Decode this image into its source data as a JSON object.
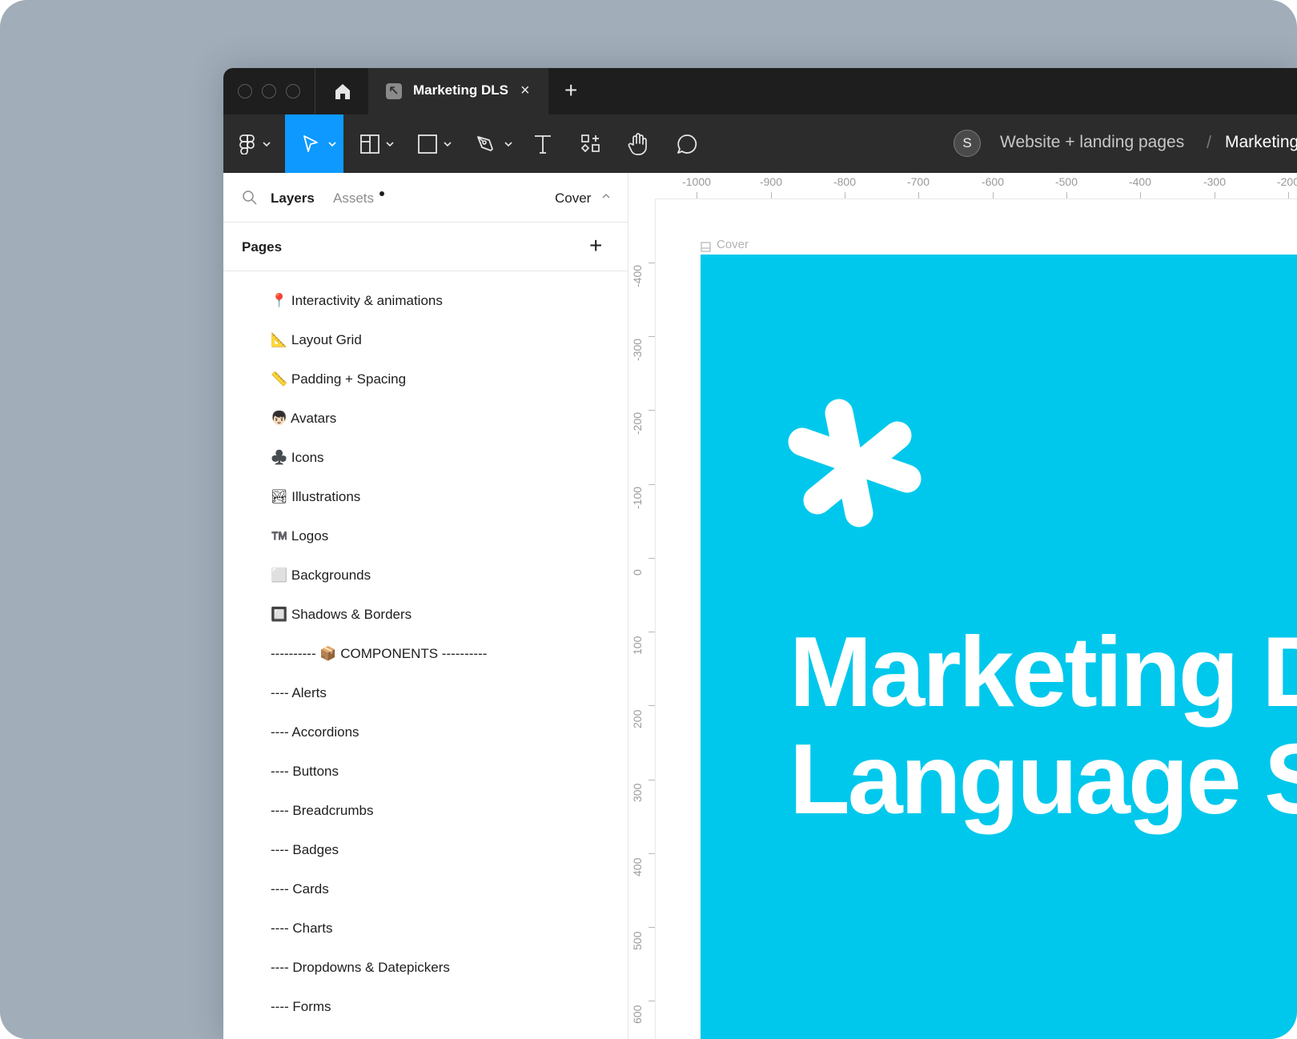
{
  "titlebar": {
    "tab_title": "Marketing DLS",
    "tab_close": "×",
    "new_tab": "+"
  },
  "toolbar": {
    "avatar_initial": "S",
    "project_name": "Website + landing pages",
    "breadcrumb_separator": "/",
    "file_name": "Marketing DLS",
    "active_tool": "move",
    "accent_color": "#0d99ff"
  },
  "panel": {
    "tab_layers": "Layers",
    "tab_assets": "Assets",
    "page_selector": "Cover",
    "pages_title": "Pages",
    "add_page": "+",
    "pages": [
      "📍 Interactivity & animations",
      "📐 Layout Grid",
      "📏 Padding + Spacing",
      "👦🏻 Avatars",
      "♣️ Icons",
      "🏞 Illustrations",
      "™️ Logos",
      "⬜ Backgrounds",
      "🔲 Shadows & Borders",
      "----------  📦 COMPONENTS  ----------",
      "---- Alerts",
      "---- Accordions",
      "---- Buttons",
      "---- Breadcrumbs",
      "---- Badges",
      "---- Cards",
      "---- Charts",
      "---- Dropdowns & Datepickers",
      "---- Forms"
    ]
  },
  "canvas": {
    "ruler_top": [
      "-1000",
      "-900",
      "-800",
      "-700",
      "-600",
      "-500",
      "-400",
      "-300",
      "-200"
    ],
    "ruler_left": [
      "-400",
      "-300",
      "-200",
      "-100",
      "0",
      "100",
      "200",
      "300",
      "400",
      "500",
      "600"
    ],
    "frame_name": "Cover",
    "frame_color": "#00c8ec",
    "cover_title": "Marketing D\nLanguage S"
  }
}
